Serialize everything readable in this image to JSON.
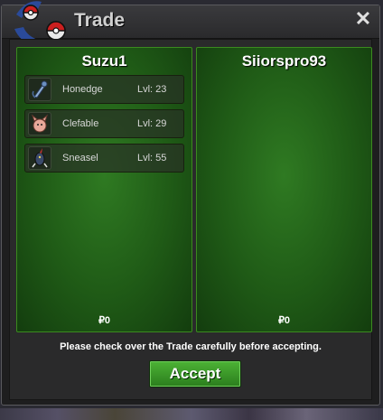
{
  "window": {
    "title": "Trade",
    "close_label": "✕"
  },
  "left_trader": {
    "name": "Suzu1",
    "pokemon": [
      {
        "name": "Honedge",
        "level": "Lvl: 23",
        "icon": "honedge-sprite"
      },
      {
        "name": "Clefable",
        "level": "Lvl: 29",
        "icon": "clefable-sprite"
      },
      {
        "name": "Sneasel",
        "level": "Lvl: 55",
        "icon": "sneasel-sprite"
      }
    ],
    "money": "₽0"
  },
  "right_trader": {
    "name": "Siiorspro93",
    "pokemon": [],
    "money": "₽0"
  },
  "notice": "Please check over the Trade carefully before accepting.",
  "accept_label": "Accept",
  "colors": {
    "panel_green": "#2f7a22",
    "accept_green": "#3e9e2a",
    "window_bg": "#1e1e1f"
  }
}
